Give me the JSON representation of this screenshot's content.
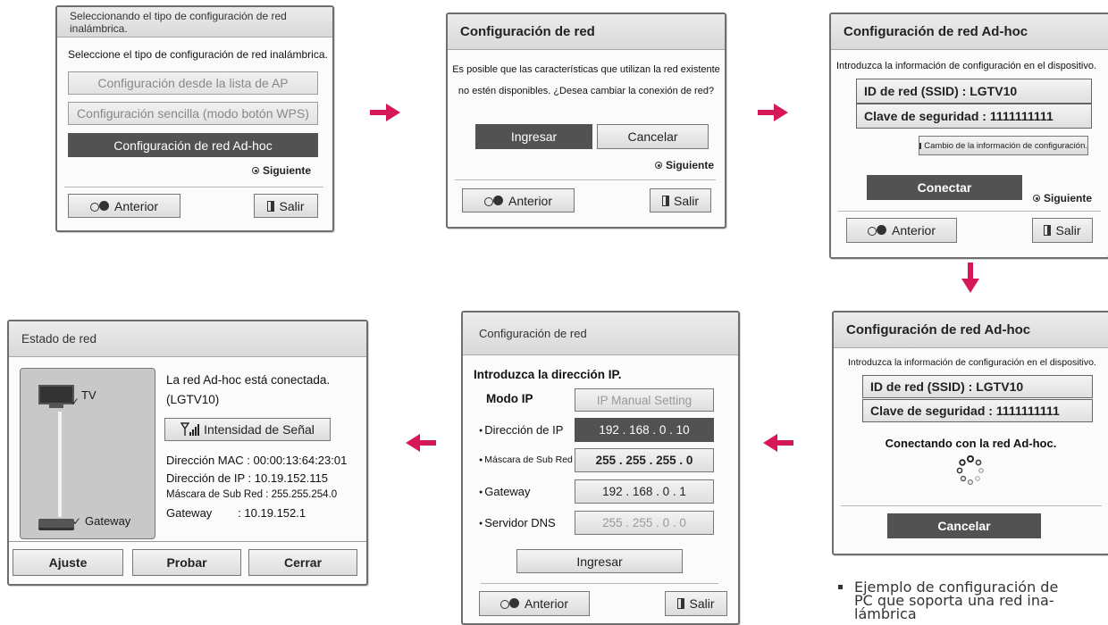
{
  "panel1": {
    "header": "Seleccionando el tipo de configuración de red inalámbrica.",
    "prompt": "Seleccione el tipo de configuración de red inalámbrica.",
    "options": [
      "Configuración desde la lista de AP",
      "Configuración sencilla (modo botón WPS)",
      "Configuración de red Ad-hoc"
    ],
    "next": "Siguiente",
    "back": "Anterior",
    "exit": "Salir"
  },
  "panel2": {
    "header": "Configuración de red",
    "message_line1": "Es posible que las características que utilizan la red existente",
    "message_line2": "no estén disponibles. ¿Desea cambiar la conexión de red?",
    "enter": "Ingresar",
    "cancel": "Cancelar",
    "next": "Siguiente",
    "back": "Anterior",
    "exit": "Salir"
  },
  "panel3": {
    "header": "Configuración de red Ad-hoc",
    "instruction": "Introduzca la información de configuración en el dispositivo.",
    "ssid": "ID de red (SSID) : LGTV10",
    "key": "Clave de seguridad : 1111111111",
    "change_info": "Cambio de la información de configuración.",
    "connect": "Conectar",
    "next": "Siguiente",
    "back": "Anterior",
    "exit": "Salir"
  },
  "panel4": {
    "header": "Configuración de red Ad-hoc",
    "instruction": "Introduzca la información de configuración en el dispositivo.",
    "ssid": "ID de red (SSID) : LGTV10",
    "key": "Clave de seguridad : 1111111111",
    "status": "Conectando con la red Ad-hoc.",
    "cancel": "Cancelar"
  },
  "panel5": {
    "header": "Configuración de red",
    "prompt": "Introduzca la dirección IP.",
    "mode_label": "Modo IP",
    "mode_value": "IP Manual Setting",
    "rows": [
      {
        "label": "Dirección de IP",
        "value": "192 . 168 . 0 . 10"
      },
      {
        "label": "Máscara de Sub Red",
        "value": "255 . 255 . 255 . 0"
      },
      {
        "label": "Gateway",
        "value": "192 . 168 . 0 . 1"
      },
      {
        "label": "Servidor DNS",
        "value": "255 . 255 . 0 . 0"
      }
    ],
    "enter": "Ingresar",
    "back": "Anterior",
    "exit": "Salir"
  },
  "panel6": {
    "header": "Estado de red",
    "tv_label": "TV",
    "gateway_label": "Gateway",
    "connected_line1": "La red Ad-hoc está conectada.",
    "connected_line2": "(LGTV10)",
    "signal_button": "Intensidad de Señal",
    "mac": "Dirección MAC : 00:00:13:64:23:01",
    "ip": "Dirección de IP : 10.19.152.115",
    "mask": "Máscara de Sub Red : 255.255.254.0",
    "gateway": "Gateway        : 10.19.152.1",
    "adjust": "Ajuste",
    "test": "Probar",
    "close": "Cerrar"
  },
  "footnote_line1": "Ejemplo de configuración de",
  "footnote_line2": "PC que soporta una red ina-",
  "footnote_line3": "lámbrica",
  "colors": {
    "accent_arrow": "#d6185a",
    "selected_bg": "#525252"
  }
}
